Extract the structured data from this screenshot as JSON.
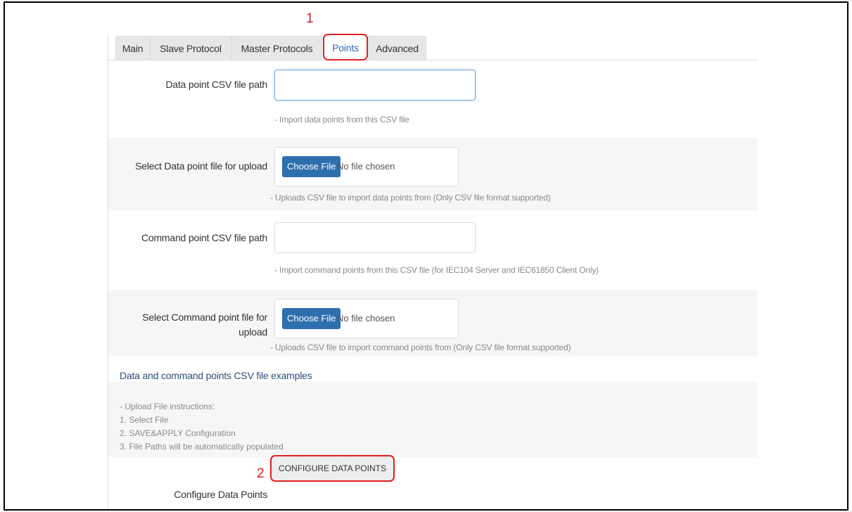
{
  "annotations": {
    "marker_1": "1",
    "marker_2": "2"
  },
  "tabs": [
    {
      "label": "Main"
    },
    {
      "label": "Slave Protocol"
    },
    {
      "label": "Master Protocols"
    },
    {
      "label": "Points"
    },
    {
      "label": "Advanced"
    }
  ],
  "active_tab": "Points",
  "fields": {
    "data_csv_path": {
      "label": "Data point CSV file path",
      "value": "",
      "help": "- Import data points from this CSV file"
    },
    "data_upload": {
      "label": "Select Data point file for upload",
      "button": "Choose File",
      "status": "No file chosen",
      "help": "- Uploads CSV file to import data points from (Only CSV file format supported)"
    },
    "command_csv_path": {
      "label": "Command point CSV file path",
      "value": "",
      "help": "- Import command points from this CSV file (for IEC104 Server and IEC61850 Client Only)"
    },
    "command_upload": {
      "label_line1": "Select Command point file for",
      "label_line2": "upload",
      "button": "Choose File",
      "status": "No file chosen",
      "help": "- Uploads CSV file to import command points from (Only CSV file format supported)"
    }
  },
  "examples": {
    "heading": "Data and command points CSV file examples",
    "instructions": [
      "- Upload File instructions:",
      "1. Select File",
      "2. SAVE&APPLY Configuration",
      "3. File Paths will be automatically populated"
    ]
  },
  "configure": {
    "label": "Configure Data Points",
    "button": "CONFIGURE DATA POINTS"
  },
  "colors": {
    "annotation": "#e02020",
    "primary_button": "#2e6fae",
    "active_tab_text": "#2a6db4"
  }
}
